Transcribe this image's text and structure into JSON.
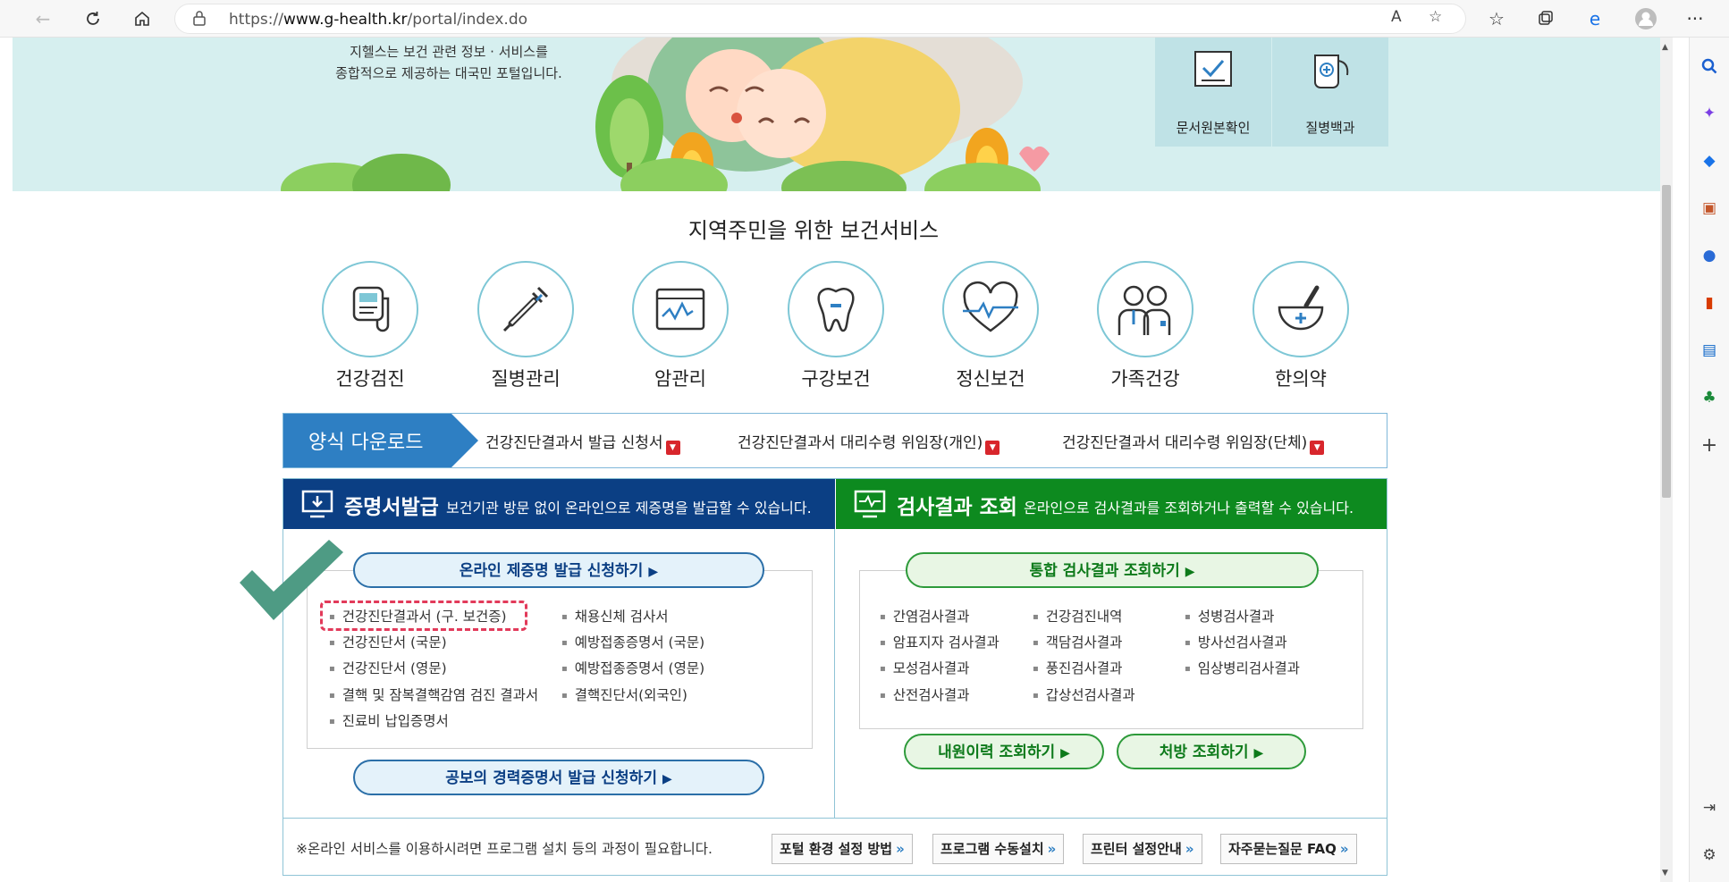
{
  "browser": {
    "url_prefix": "https://",
    "url_host": "www.g-health.kr",
    "url_path": "/portal/index.do",
    "read_aloud": "A",
    "menu": "···"
  },
  "banner": {
    "text_line1": "지헬스는 보건 관련 정보 · 서비스를",
    "text_line2": "종합적으로 제공하는 대국민 포털입니다.",
    "quick_links": [
      "문서원본확인",
      "질병백과"
    ]
  },
  "services": {
    "title": "지역주민을 위한 보건서비스",
    "items": [
      "건강검진",
      "질병관리",
      "암관리",
      "구강보건",
      "정신보건",
      "가족건강",
      "한의약"
    ]
  },
  "forms": {
    "tag": "양식 다운로드",
    "links": [
      "건강진단결과서 발급 신청서",
      "건강진단결과서 대리수령 위임장(개인)",
      "건강진단결과서 대리수령 위임장(단체)"
    ]
  },
  "certificate": {
    "title": "증명서발급",
    "subtitle": "보건기관 방문 없이 온라인으로 제증명을 발급할 수 있습니다.",
    "apply_button": "온라인 제증명 발급 신청하기",
    "items_col1": [
      "건강진단결과서 (구. 보건증)",
      "건강진단서 (국문)",
      "건강진단서 (영문)",
      "결핵 및 잠복결핵감염 검진 결과서",
      "진료비 납입증명서"
    ],
    "items_col2": [
      "채용신체 검사서",
      "예방접종증명서 (국문)",
      "예방접종증명서 (영문)",
      "결핵진단서(외국인)"
    ],
    "career_button": "공보의 경력증명서 발급 신청하기"
  },
  "results": {
    "title": "검사결과 조회",
    "subtitle": "온라인으로 검사결과를 조회하거나 출력할 수 있습니다.",
    "integrated_button": "통합 검사결과 조회하기",
    "items_col1": [
      "간염검사결과",
      "암표지자 검사결과",
      "모성검사결과",
      "산전검사결과"
    ],
    "items_col2": [
      "건강검진내역",
      "객담검사결과",
      "풍진검사결과",
      "갑상선검사결과"
    ],
    "items_col3": [
      "성병검사결과",
      "방사선검사결과",
      "임상병리검사결과"
    ],
    "visit_button": "내원이력 조회하기",
    "prescription_button": "처방 조회하기"
  },
  "footer": {
    "note": "※온라인 서비스를 이용하시려면 프로그램 설치 등의 과정이 필요합니다.",
    "buttons": [
      "포털 환경 설정 방법",
      "프로그램 수동설치",
      "프린터 설정안내",
      "자주묻는질문 FAQ"
    ]
  },
  "colors": {
    "certificate_header": "#0b3f84",
    "results_header": "#0d8a1f",
    "form_tag": "#2e7fc3",
    "highlight": "#e23a5a",
    "checkmark": "#4e9b84"
  }
}
